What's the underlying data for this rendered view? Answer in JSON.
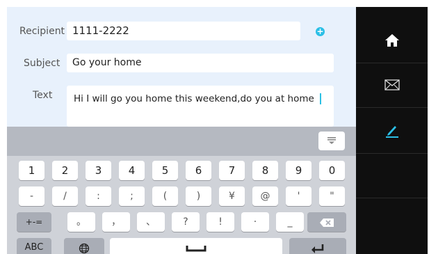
{
  "form": {
    "recipient_label": "Recipient",
    "recipient_value": "1111-2222",
    "subject_label": "Subject",
    "subject_value": "Go your home",
    "text_label": "Text",
    "text_value": "Hi I will go you home this weekend,do you at home"
  },
  "icons": {
    "add": "plus-circle-icon",
    "collapse": "keyboard-collapse-icon",
    "home": "home-icon",
    "mail": "mail-icon",
    "compose": "pencil-icon",
    "globe": "globe-icon",
    "space": "space-bar-icon",
    "enter": "enter-icon",
    "delete": "backspace-icon"
  },
  "colors": {
    "accent": "#2bbfe6",
    "compose_bg": "#e8f1fc",
    "sidebar_bg": "#0f0f0f",
    "keyboard_bg": "#cfd2d8"
  },
  "keyboard": {
    "row1": [
      "1",
      "2",
      "3",
      "4",
      "5",
      "6",
      "7",
      "8",
      "9",
      "0"
    ],
    "row2": [
      "-",
      "/",
      ":",
      ";",
      "(",
      ")",
      "¥",
      "@",
      "'",
      "\""
    ],
    "row3": [
      "+-=",
      "。",
      "，",
      "、",
      "?",
      "!",
      "·",
      "_"
    ],
    "abc_label": "ABC"
  }
}
